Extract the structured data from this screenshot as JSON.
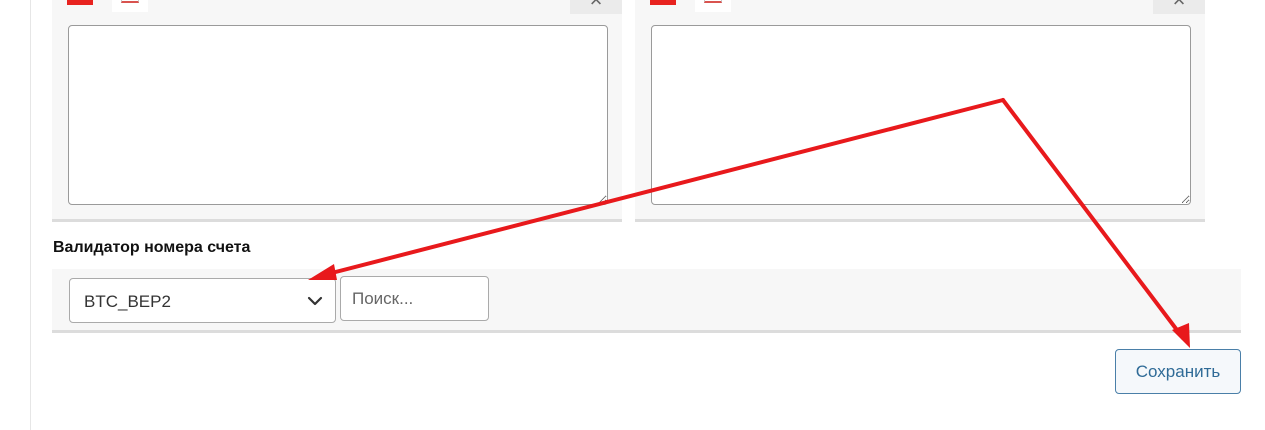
{
  "validator": {
    "label": "Валидатор номера счета",
    "selected": "BTC_BEP2",
    "search_placeholder": "Поиск..."
  },
  "actions": {
    "save_label": "Сохранить"
  },
  "panels": [
    {
      "close_glyph": "×"
    },
    {
      "close_glyph": "×"
    }
  ],
  "icons": {
    "select_caret": "chevron-down-icon",
    "annotation": "red-arrow-annotation"
  },
  "colors": {
    "accent": "#2f6b97",
    "annotation_red": "#e8191c",
    "flag_red": "#e8231f"
  }
}
